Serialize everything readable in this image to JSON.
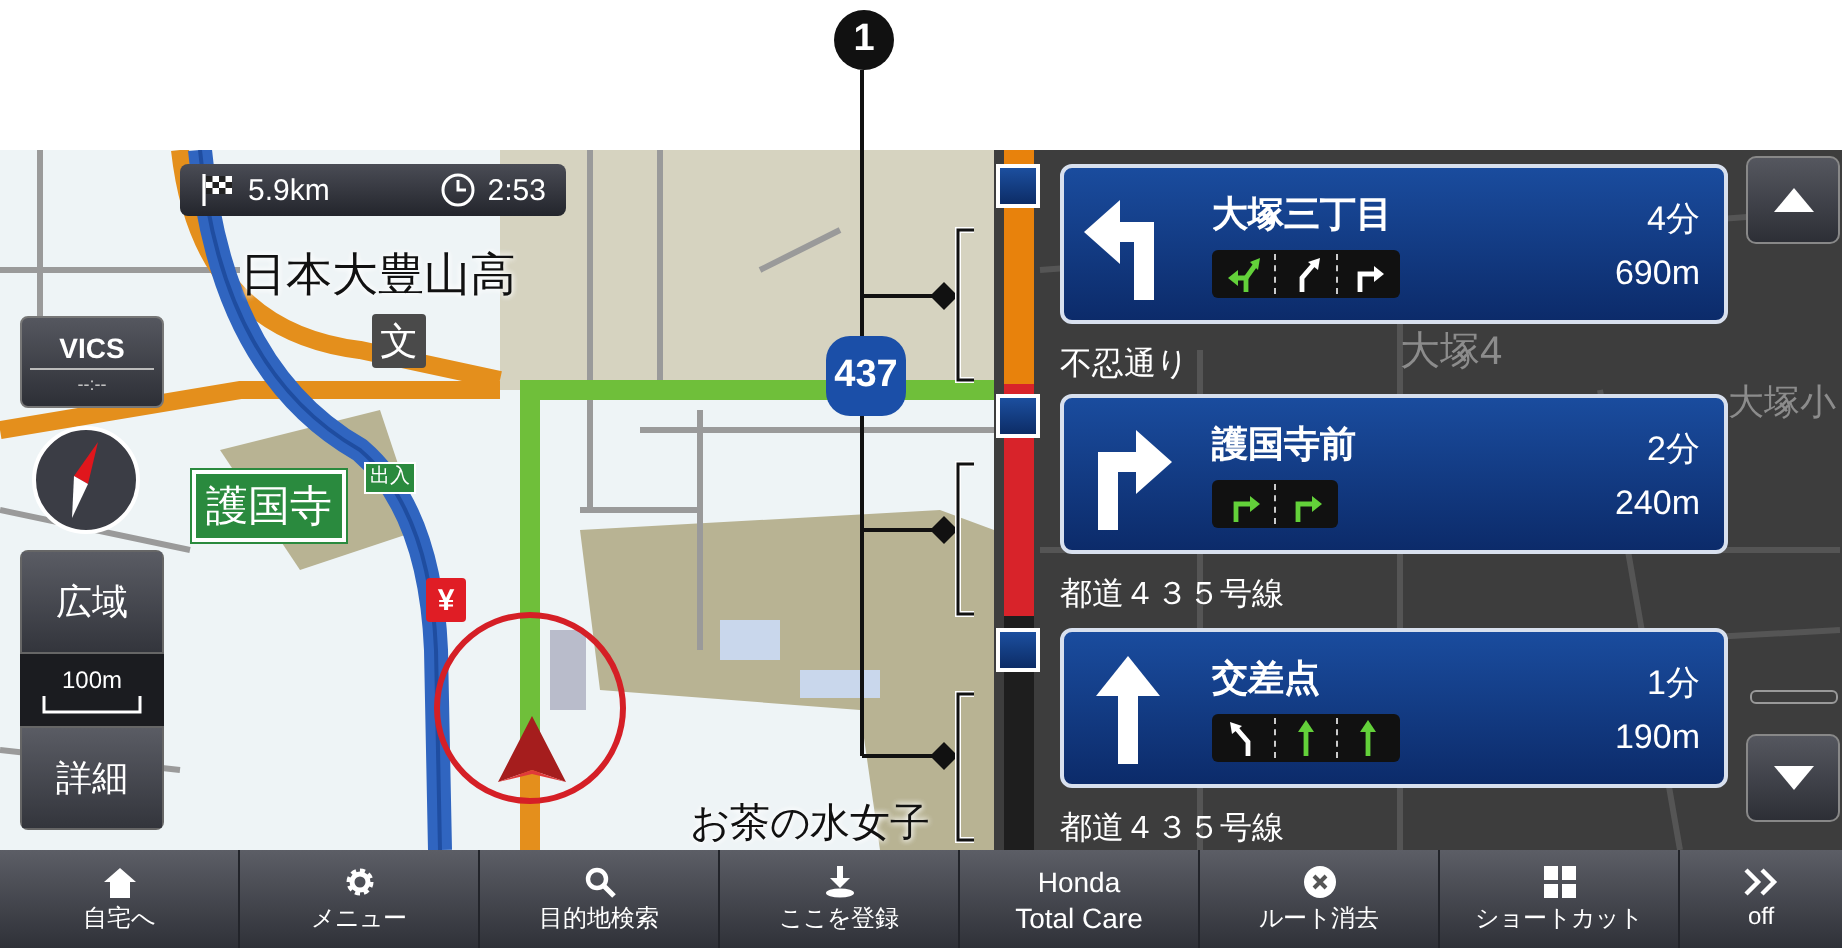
{
  "callout": {
    "number": "1"
  },
  "trip": {
    "distance": "5.9km",
    "time": "2:53"
  },
  "map": {
    "school_name": "日本大豊山高",
    "school_mark": "文",
    "interchange": "護国寺",
    "interchange_tag": "出入",
    "bank_mark": "¥",
    "route_number": "437",
    "university_name": "お茶の水女子",
    "district": "大塚4",
    "district_school": "大塚小"
  },
  "vics": {
    "label": "VICS",
    "time": "--:--"
  },
  "zoom": {
    "wide": "広域",
    "scale": "100m",
    "detail": "詳細"
  },
  "guidance": [
    {
      "name": "大塚三丁目",
      "time": "4分",
      "distance": "690m",
      "kind": "left",
      "road_after": "不忍通り",
      "color": "#e8820c",
      "lanes": [
        {
          "kind": "left-slight-right",
          "recommended": true
        },
        {
          "kind": "slight-right",
          "recommended": false
        },
        {
          "kind": "right",
          "recommended": false
        }
      ]
    },
    {
      "name": "護国寺前",
      "time": "2分",
      "distance": "240m",
      "kind": "right",
      "road_after": "都道４３５号線",
      "color": "#d8232a",
      "lanes": [
        {
          "kind": "right",
          "recommended": true
        },
        {
          "kind": "right",
          "recommended": true
        }
      ]
    },
    {
      "name": "交差点",
      "time": "1分",
      "distance": "190m",
      "kind": "straight",
      "road_after": "都道４３５号線",
      "color": "#1e1e1e",
      "lanes": [
        {
          "kind": "slight-left",
          "recommended": false
        },
        {
          "kind": "straight",
          "recommended": true
        },
        {
          "kind": "straight",
          "recommended": true
        }
      ]
    }
  ],
  "nav_bar": [
    {
      "kind": "home",
      "label": "自宅へ"
    },
    {
      "kind": "settings",
      "label": "メニュー"
    },
    {
      "kind": "search",
      "label": "目的地検索"
    },
    {
      "kind": "register",
      "label": "ここを登録"
    },
    {
      "kind": "text",
      "label": "Honda\nTotal Care"
    },
    {
      "kind": "clear",
      "label": "ルート消去"
    },
    {
      "kind": "shortcut",
      "label": "ショートカット"
    },
    {
      "kind": "more",
      "label": "off"
    }
  ]
}
